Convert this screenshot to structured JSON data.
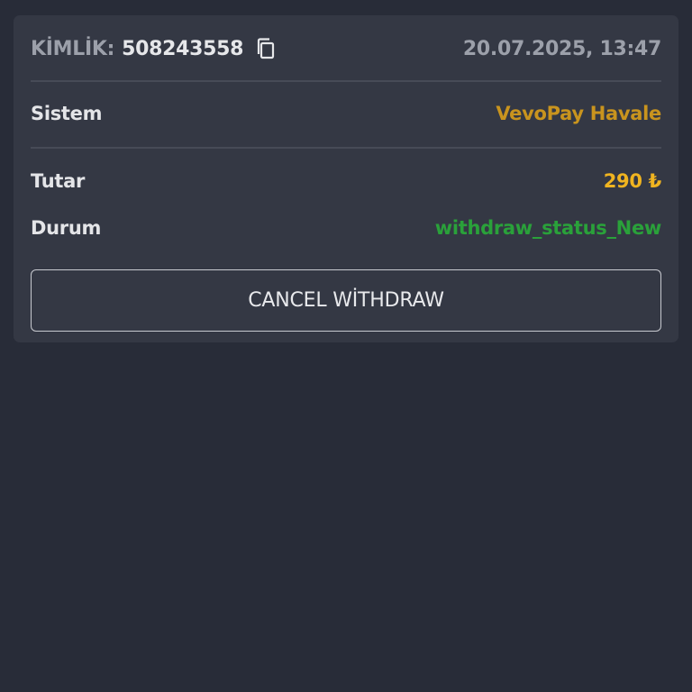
{
  "transaction": {
    "id_label": "KİMLİK:",
    "id_value": "508243558",
    "datetime": "20.07.2025, 13:47",
    "system_label": "Sistem",
    "system_value": "VevoPay Havale",
    "amount_label": "Tutar",
    "amount_value": "290 ₺",
    "status_label": "Durum",
    "status_value": "withdraw_status_New"
  },
  "actions": {
    "cancel_label": "CANCEL WİTHDRAW"
  },
  "icons": {
    "copy": "copy-icon"
  },
  "colors": {
    "background": "#282c38",
    "card": "#343844",
    "system_accent": "#c9941e",
    "amount_accent": "#f0b420",
    "status_accent": "#2aa13a"
  }
}
